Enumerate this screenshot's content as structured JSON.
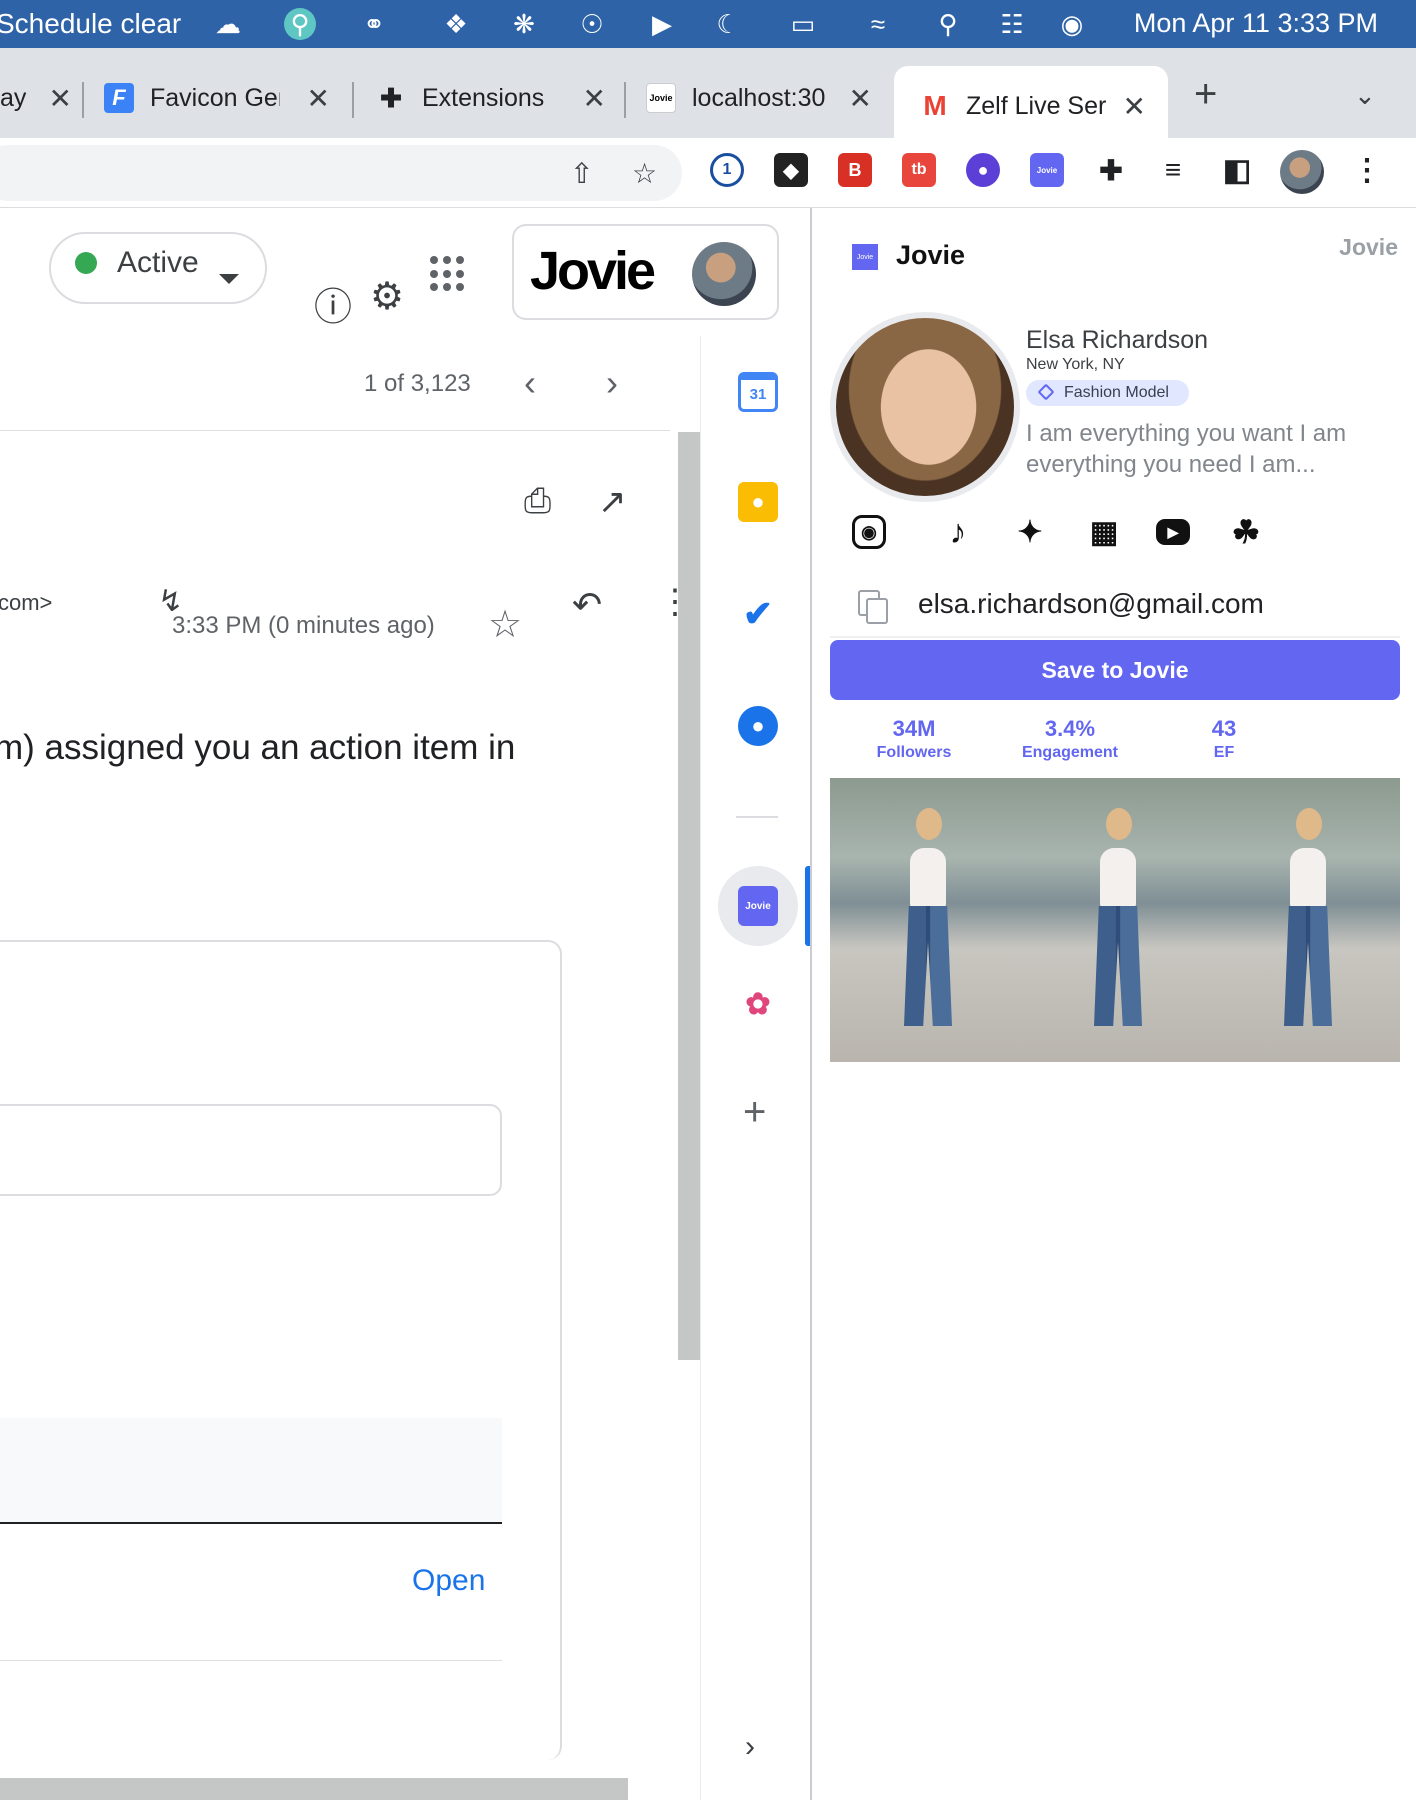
{
  "menubar": {
    "title": "Schedule clear",
    "clock": "Mon Apr 11  3:33 PM"
  },
  "tabs": [
    {
      "label": "ay",
      "favicon": ""
    },
    {
      "label": "Favicon Gen",
      "favicon": "F"
    },
    {
      "label": "Extensions",
      "favicon": "puzzle-icon"
    },
    {
      "label": "localhost:30",
      "favicon": "Jovie"
    },
    {
      "label": "Zelf Live Ser",
      "favicon": "M",
      "active": true
    }
  ],
  "gmail": {
    "status": "Active",
    "account_logo": "Jovie",
    "pager": "1 of 3,123",
    "sender_email_fragment": "com>",
    "time": "3:33 PM (0 minutes ago)",
    "message_line": "m) assigned you an action item in",
    "open_link": "Open"
  },
  "rail": {
    "calendar_label": "31",
    "jovie_label": "Jovie"
  },
  "panel": {
    "brand_icon": "Jovie",
    "brand_name": "Jovie",
    "corner_label": "Jovie",
    "profile": {
      "name": "Elsa Richardson",
      "location": "New York, NY",
      "tag": "Fashion Model",
      "bio": "I am everything you want I am everything you need I am..."
    },
    "socials": [
      "instagram-icon",
      "tiktok-icon",
      "twitter-icon",
      "twitch-icon",
      "youtube-icon",
      "snapchat-icon"
    ],
    "email": "elsa.richardson@gmail.com",
    "save_label": "Save to Jovie",
    "stats": [
      {
        "value": "34M",
        "label": "Followers"
      },
      {
        "value": "3.4%",
        "label": "Engagement"
      },
      {
        "value": "43",
        "label": "EF"
      }
    ]
  },
  "colors": {
    "menubar": "#2f63a8",
    "jovie_accent": "#6366f1",
    "gmail_link": "#1a73e8",
    "status_active": "#34a853"
  }
}
